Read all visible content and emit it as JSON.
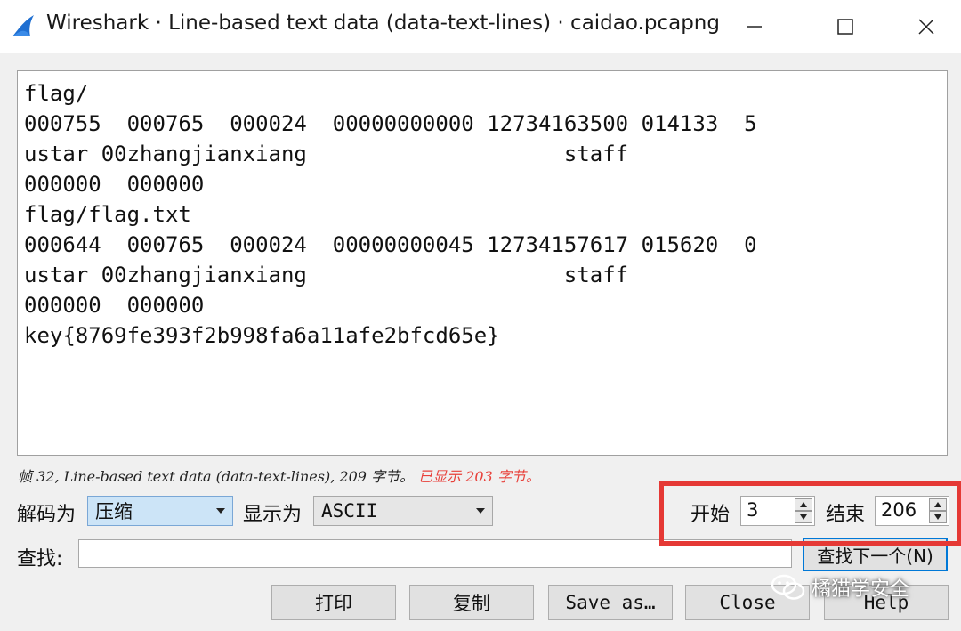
{
  "window": {
    "title": "Wireshark · Line-based text data (data-text-lines) · caidao.pcapng",
    "icon": "wireshark-fin-icon",
    "controls": [
      "minimize-icon",
      "maximize-icon",
      "close-icon"
    ]
  },
  "text_lines": [
    "flag/",
    "000755  000765  000024  00000000000 12734163500 014133  5",
    "ustar 00zhangjianxiang                    staff",
    "000000  000000",
    "flag/flag.txt",
    "000644  000765  000024  00000000045 12734157617 015620  0",
    "ustar 00zhangjianxiang                    staff",
    "000000  000000",
    "key{8769fe393f2b998fa6a11afe2bfcd65e}"
  ],
  "status": {
    "main": "帧 32, Line-based text data (data-text-lines), 209 字节。",
    "shown": "已显示 203 字节。"
  },
  "controls": {
    "decode_label": "解码为",
    "decode_value": "压缩",
    "show_label": "显示为",
    "show_value": "ASCII",
    "start_label": "开始",
    "start_value": "3",
    "end_label": "结束",
    "end_value": "206",
    "find_label": "查找:",
    "find_value": "",
    "find_next_label": "查找下一个(N)"
  },
  "buttons": {
    "print": "打印",
    "copy": "复制",
    "save_as": "Save as…",
    "close": "Close",
    "help": "Help"
  },
  "watermark": {
    "text": "橘猫学安全",
    "icon": "wechat-icon"
  },
  "colors": {
    "highlight": "#e53935",
    "status_red": "#e8413b",
    "accent": "#0078d7",
    "selected_combo": "#cce4f7"
  }
}
